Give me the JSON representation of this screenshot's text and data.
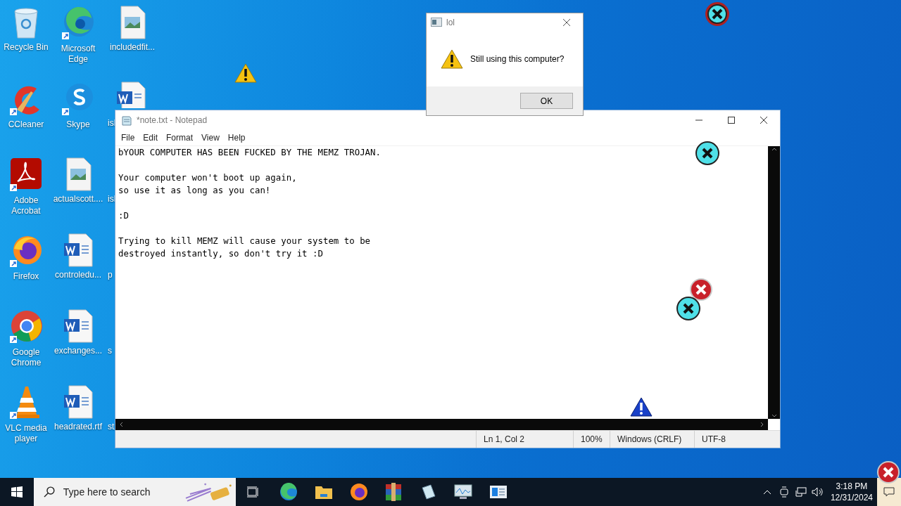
{
  "desktop_icons": [
    {
      "label": "Recycle Bin",
      "kind": "recycle"
    },
    {
      "label": "CCleaner",
      "kind": "ccleaner"
    },
    {
      "label": "Adobe Acrobat",
      "kind": "acrobat"
    },
    {
      "label": "Firefox",
      "kind": "firefox"
    },
    {
      "label": "Google Chrome",
      "kind": "chrome"
    },
    {
      "label": "VLC media player",
      "kind": "vlc"
    },
    {
      "label": "Microsoft Edge",
      "kind": "edge"
    },
    {
      "label": "Skype",
      "kind": "skype"
    },
    {
      "label": "actualscott....",
      "kind": "image"
    },
    {
      "label": "controledu...",
      "kind": "word"
    },
    {
      "label": "exchanges...",
      "kind": "word"
    },
    {
      "label": "headrated.rtf",
      "kind": "word"
    },
    {
      "label": "includedfit...",
      "kind": "image"
    },
    {
      "label": "isl",
      "kind": "word-covered"
    },
    {
      "label": "isl",
      "kind": "covered"
    },
    {
      "label": "p",
      "kind": "covered"
    },
    {
      "label": "s",
      "kind": "covered"
    },
    {
      "label": "st",
      "kind": "covered"
    }
  ],
  "dialog": {
    "title": "lol",
    "message": "Still using this computer?",
    "button": "OK"
  },
  "notepad": {
    "title": "*note.txt - Notepad",
    "menu": [
      "File",
      "Edit",
      "Format",
      "View",
      "Help"
    ],
    "text": "bYOUR COMPUTER HAS BEEN FUCKED BY THE MEMZ TROJAN.\n\nYour computer won't boot up again,\nso use it as long as you can!\n\n:D\n\nTrying to kill MEMZ will cause your system to be\ndestroyed instantly, so don't try it :D",
    "status": [
      "Ln 1, Col 2",
      "100%",
      "Windows (CRLF)",
      "UTF-8"
    ]
  },
  "taskbar": {
    "search_placeholder": "Type here to search",
    "time": "3:18 PM",
    "date": "12/31/2024"
  }
}
